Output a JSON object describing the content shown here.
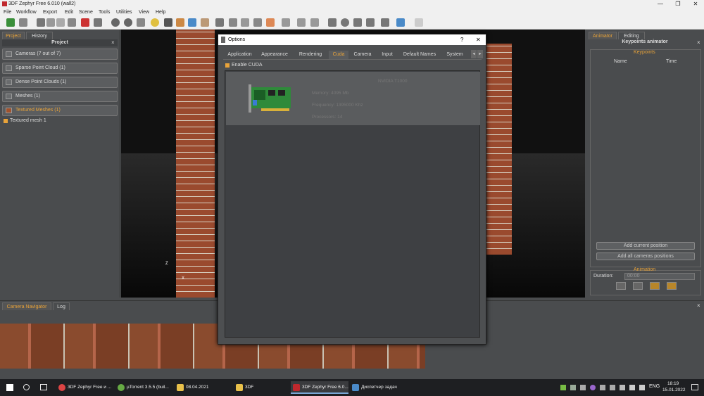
{
  "window": {
    "title": "3DF Zephyr Free 6.010 (wall2)",
    "controls": [
      "—",
      "❐",
      "✕"
    ]
  },
  "menu": [
    "File",
    "Workflow",
    "Export",
    "Edit",
    "Scene",
    "Tools",
    "Utilities",
    "View",
    "Help"
  ],
  "left": {
    "tabs": [
      "Project",
      "History"
    ],
    "header": "Project",
    "close": "×",
    "items": [
      "Cameras (7 out of 7)",
      "Sparse Point Cloud (1)",
      "Dense Point Clouds (1)",
      "Meshes (1)",
      "Textured Meshes (1)"
    ],
    "subitem": "Textured mesh 1"
  },
  "viewport": {
    "axis_z": "Z",
    "axis_x": "X"
  },
  "right": {
    "tabs": [
      "Animator",
      "Editing"
    ],
    "title": "Keypoints animator",
    "close": "×",
    "keypoints_label": "Keypoints",
    "columns": [
      "Name",
      "Time"
    ],
    "add_current": "Add current position",
    "add_all": "Add all cameras positions",
    "animation_label": "Animation",
    "duration_label": "Duration:",
    "duration_value": "00:00"
  },
  "bottom": {
    "tabs": [
      "Camera Navigator",
      "Log"
    ],
    "close": "×"
  },
  "dialog": {
    "title": "Options",
    "help": "?",
    "close": "✕",
    "tabs": [
      "Application",
      "Appearance",
      "Rendering",
      "Cuda",
      "Camera",
      "Input",
      "Default Names",
      "System"
    ],
    "enable_cuda": "Enable CUDA",
    "gpu_name": "NVIDIA T1000",
    "memory": "Memory: 4095 Mb",
    "frequency": "Frequency: 1395000 Khz",
    "processors": "Processors: 14"
  },
  "taskbar": {
    "tasks": [
      "3DF Zephyr Free и ...",
      "µTorrent 3.5.5  (buil...",
      "08.04.2021",
      "3DF",
      "3DF Zephyr Free 6.0...",
      "Диспетчер задач"
    ],
    "lang": "ENG",
    "time": "18:19",
    "date": "15.01.2022"
  },
  "colors": {
    "accent": "#e8a33a",
    "panel": "#4a4c4e",
    "dialog": "#4d4f51"
  }
}
